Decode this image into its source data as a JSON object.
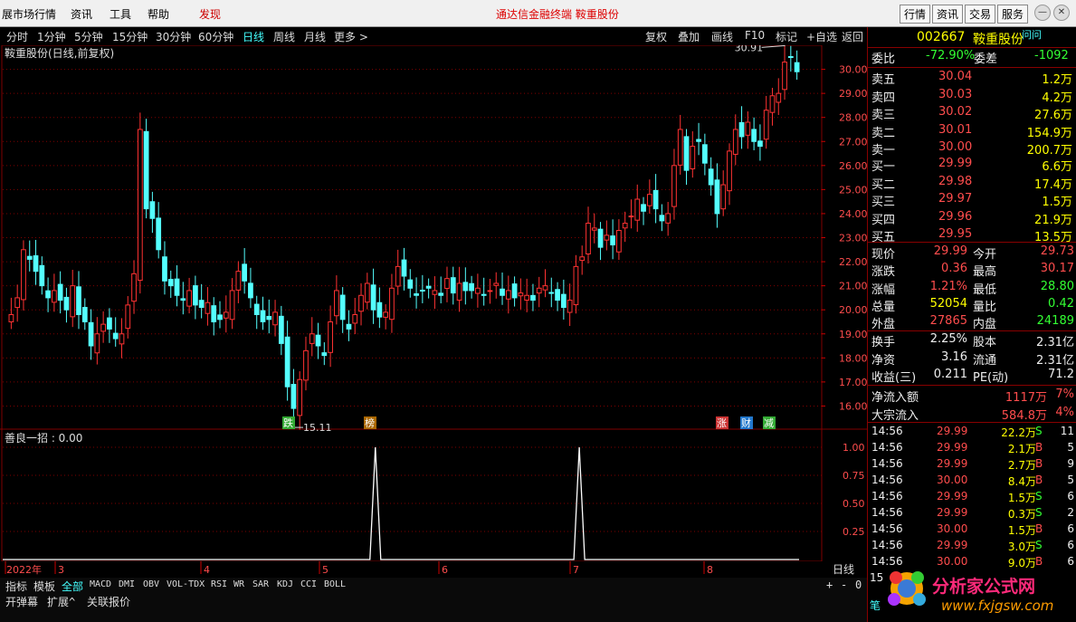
{
  "menubar": {
    "items": [
      "展市场行情",
      "资讯",
      "工具",
      "帮助",
      "发现"
    ],
    "center": "通达信金融终端  鞍重股份",
    "tabs": [
      "行情",
      "资讯",
      "交易",
      "服务"
    ]
  },
  "periods": [
    "分时",
    "1分钟",
    "5分钟",
    "15分钟",
    "30分钟",
    "60分钟",
    "日线",
    "周线",
    "月线",
    "更多 >"
  ],
  "tools": [
    "复权",
    "叠加",
    "画线",
    "F10",
    "标记",
    "+自选",
    "返回"
  ],
  "chart": {
    "title": "鞍重股份(日线,前复权)",
    "price_labels": [
      "30.00",
      "29.00",
      "28.00",
      "27.00",
      "26.00",
      "25.00",
      "24.00",
      "23.00",
      "22.00",
      "21.00",
      "20.00",
      "19.00",
      "18.00",
      "17.00",
      "16.00"
    ],
    "high_label": "30.91",
    "low_label": "15.11",
    "markers": [
      "跌",
      "榜",
      "涨",
      "财",
      "减"
    ],
    "indicator_title": "善良一招 : 0.00",
    "ind_axis": [
      "1.00",
      "0.75",
      "0.50",
      "0.25"
    ],
    "x_labels": [
      "2022年",
      "3",
      "4",
      "5",
      "6",
      "7",
      "8"
    ],
    "period_label": "日线",
    "up": "#ff3232",
    "down": "#54ffff",
    "grid": "#800000"
  },
  "chart_data": {
    "type": "candlestick",
    "title": "鞍重股份(日线,前复权)",
    "ylim": [
      15,
      31
    ],
    "max": 30.91,
    "min": 15.11,
    "indicator": {
      "name": "善良一招",
      "value": 0,
      "ylim": [
        0,
        1
      ],
      "spikes_at_fraction": [
        0.455,
        0.704
      ],
      "spike_value": 1
    }
  },
  "bottom": {
    "tabs": [
      "指标",
      "模板",
      "全部",
      "MACD",
      "DMI",
      "OBV",
      "VOL-TDX",
      "RSI",
      "WR",
      "SAR",
      "KDJ",
      "CCI",
      "BOLL"
    ],
    "row3": [
      "开弹幕",
      "扩展^",
      "关联报价"
    ],
    "ctrl": [
      "+",
      "-",
      "0"
    ]
  },
  "quote": {
    "code": "002667",
    "name": "鞍重股份",
    "extra": "问问",
    "wb_label": "委比",
    "wb": "-72.90%",
    "wc_label": "委差",
    "wc": "-1092",
    "sell": [
      [
        "卖五",
        "30.04",
        "1.2万"
      ],
      [
        "卖四",
        "30.03",
        "4.2万"
      ],
      [
        "卖三",
        "30.02",
        "27.6万"
      ],
      [
        "卖二",
        "30.01",
        "154.9万"
      ],
      [
        "卖一",
        "30.00",
        "200.7万"
      ]
    ],
    "buy": [
      [
        "买一",
        "29.99",
        "6.6万"
      ],
      [
        "买二",
        "29.98",
        "17.4万"
      ],
      [
        "买三",
        "29.97",
        "1.5万"
      ],
      [
        "买四",
        "29.96",
        "21.9万"
      ],
      [
        "买五",
        "29.95",
        "13.5万"
      ]
    ],
    "stats": [
      [
        "现价",
        "29.99",
        "今开",
        "29.73"
      ],
      [
        "涨跌",
        "0.36",
        "最高",
        "30.17"
      ],
      [
        "涨幅",
        "1.21%",
        "最低",
        "28.80"
      ],
      [
        "总量",
        "52054",
        "量比",
        "0.42"
      ],
      [
        "外盘",
        "27865",
        "内盘",
        "24189"
      ]
    ],
    "stats2": [
      [
        "换手",
        "2.25%",
        "股本",
        "2.31亿"
      ],
      [
        "净资",
        "3.16",
        "流通",
        "2.31亿"
      ],
      [
        "收益(三)",
        "0.211",
        "PE(动)",
        "71.2"
      ]
    ],
    "flow": [
      [
        "净流入额",
        "1117万",
        "7%"
      ],
      [
        "大宗流入",
        "584.8万",
        "4%"
      ]
    ],
    "ticks": [
      [
        "14:56",
        "29.99",
        "22.2万",
        "S",
        "11"
      ],
      [
        "14:56",
        "29.99",
        "2.1万",
        "B",
        "5"
      ],
      [
        "14:56",
        "29.99",
        "2.7万",
        "B",
        "9"
      ],
      [
        "14:56",
        "30.00",
        "8.4万",
        "B",
        "5"
      ],
      [
        "14:56",
        "29.99",
        "1.5万",
        "S",
        "6"
      ],
      [
        "14:56",
        "29.99",
        "0.3万",
        "S",
        "2"
      ],
      [
        "14:56",
        "30.00",
        "1.5万",
        "B",
        "6"
      ],
      [
        "14:56",
        "29.99",
        "3.0万",
        "S",
        "6"
      ],
      [
        "14:56",
        "30.00",
        "9.0万",
        "B",
        "6"
      ]
    ],
    "tick_tail": "15",
    "footer_tab": "笔"
  },
  "logo": {
    "line1": "分析家公式网",
    "line2": "www.fxjgsw.com"
  }
}
